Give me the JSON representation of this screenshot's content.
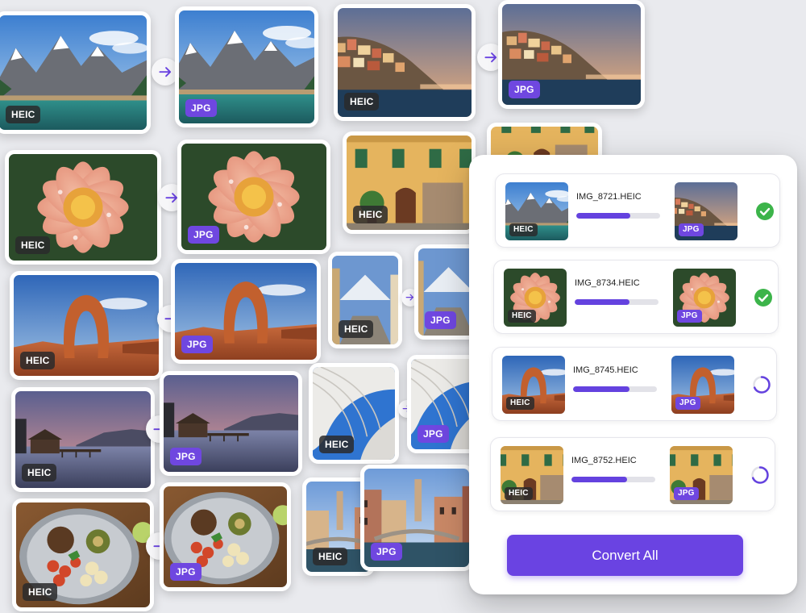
{
  "labels": {
    "heic": "HEIC",
    "jpg": "JPG"
  },
  "colors": {
    "accent": "#6a43e2",
    "progress": "#6442df",
    "success": "#3cb44a",
    "badge_heic": "#2a2a2c",
    "badge_jpg": "#6f47e0"
  },
  "icons": [
    "arrow-right-icon",
    "check-circle-icon",
    "loading-spinner-icon"
  ],
  "panel": {
    "files": [
      {
        "name": "IMG_8721.HEIC",
        "progress": 0.64,
        "status": "done"
      },
      {
        "name": "IMG_8734.HEIC",
        "progress": 0.65,
        "status": "done"
      },
      {
        "name": "IMG_8745.HEIC",
        "progress": 0.67,
        "status": "converting"
      },
      {
        "name": "IMG_8752.HEIC",
        "progress": 0.66,
        "status": "converting"
      }
    ],
    "convert_label": "Convert All"
  }
}
